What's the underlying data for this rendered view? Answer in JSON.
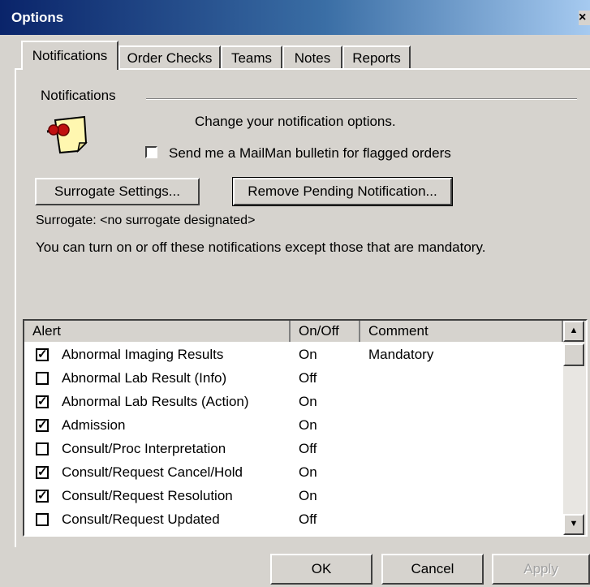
{
  "window": {
    "title": "Options",
    "close_glyph": "×"
  },
  "tabs": [
    {
      "label": "Notifications",
      "active": true
    },
    {
      "label": "Order Checks",
      "active": false
    },
    {
      "label": "Teams",
      "active": false
    },
    {
      "label": "Notes",
      "active": false
    },
    {
      "label": "Reports",
      "active": false
    }
  ],
  "notifications": {
    "group_label": "Notifications",
    "description": "Change your notification options.",
    "mailman_checkbox": {
      "label": "Send me a MailMan bulletin for flagged orders",
      "checked": false
    },
    "surrogate_button": "Surrogate Settings...",
    "remove_pending_button": "Remove Pending Notification...",
    "surrogate_text": "Surrogate: <no surrogate designated>",
    "info_text": "You can turn on or off these notifications except those that are mandatory.",
    "icon": "notepad-pushpin-icon"
  },
  "alerts_table": {
    "columns": [
      "Alert",
      "On/Off",
      "Comment"
    ],
    "rows": [
      {
        "checked": true,
        "alert": "Abnormal Imaging Results",
        "on_off": "On",
        "comment": "Mandatory"
      },
      {
        "checked": false,
        "alert": "Abnormal Lab Result (Info)",
        "on_off": "Off",
        "comment": ""
      },
      {
        "checked": true,
        "alert": "Abnormal Lab Results (Action)",
        "on_off": "On",
        "comment": ""
      },
      {
        "checked": true,
        "alert": "Admission",
        "on_off": "On",
        "comment": ""
      },
      {
        "checked": false,
        "alert": "Consult/Proc Interpretation",
        "on_off": "Off",
        "comment": ""
      },
      {
        "checked": true,
        "alert": "Consult/Request Cancel/Hold",
        "on_off": "On",
        "comment": ""
      },
      {
        "checked": true,
        "alert": "Consult/Request Resolution",
        "on_off": "On",
        "comment": ""
      },
      {
        "checked": false,
        "alert": "Consult/Request Updated",
        "on_off": "Off",
        "comment": ""
      }
    ],
    "check_glyph": "✓",
    "scroll_up_glyph": "▲",
    "scroll_down_glyph": "▼"
  },
  "footer": {
    "ok": "OK",
    "cancel": "Cancel",
    "apply": "Apply"
  },
  "colors": {
    "titlebar": "#0a246a",
    "face": "#d6d3ce",
    "disabled_text": "#a0a0a0"
  }
}
